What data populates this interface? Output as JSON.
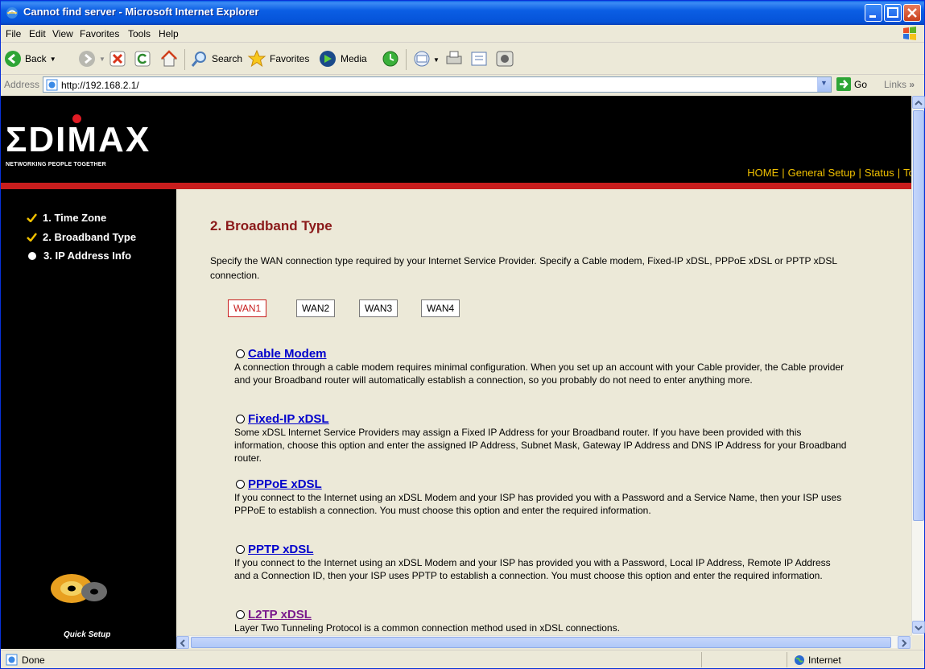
{
  "window": {
    "title": "Cannot find server - Microsoft Internet Explorer"
  },
  "menu": [
    "File",
    "Edit",
    "View",
    "Favorites",
    "Tools",
    "Help"
  ],
  "toolbar": {
    "back_label": "Back",
    "search_label": "Search",
    "favorites_label": "Favorites",
    "media_label": "Media"
  },
  "address": {
    "label": "Address",
    "url": "http://192.168.2.1/",
    "go_label": "Go",
    "links_label": "Links"
  },
  "brand": {
    "logo": "ΣDIMAX",
    "tagline": "NETWORKING PEOPLE TOGETHER"
  },
  "topnav": [
    "HOME",
    "General Setup",
    "Status",
    "Tool"
  ],
  "sidebar": {
    "items": [
      {
        "label": "1. Time Zone",
        "state": "checked"
      },
      {
        "label": "2. Broadband Type",
        "state": "checked"
      },
      {
        "label": "3. IP Address Info",
        "state": "current"
      }
    ],
    "quick_setup_label": "Quick Setup"
  },
  "content": {
    "title": "2. Broadband Type",
    "description": "Specify the WAN connection type required by your Internet Service Provider. Specify a Cable modem, Fixed-IP xDSL, PPPoE xDSL or PPTP xDSL connection.",
    "wan_buttons": [
      "WAN1",
      "WAN2",
      "WAN3",
      "WAN4"
    ],
    "options": [
      {
        "label": "Cable Modem",
        "text": "A connection through a cable modem requires minimal configuration. When you set up an account with your Cable provider, the Cable provider and your Broadband router will automatically establish a connection, so you probably do not need to enter anything more."
      },
      {
        "label": "Fixed-IP xDSL",
        "text": "Some xDSL Internet Service Providers may assign a Fixed IP Address for your Broadband router. If you have been provided with this information, choose this option and enter the assigned IP Address, Subnet Mask, Gateway IP Address and DNS IP Address for your Broadband router."
      },
      {
        "label": "PPPoE xDSL",
        "text": "If you connect to the Internet using an xDSL Modem and your ISP has provided you with a Password and a Service Name, then your ISP uses PPPoE to establish a connection. You must choose this option and enter the required information."
      },
      {
        "label": "PPTP xDSL",
        "text": "If you connect to the Internet using an xDSL Modem and your ISP has provided you with a Password, Local IP Address, Remote IP Address and a Connection ID, then your ISP uses PPTP to establish a connection. You must choose this option and enter the required information."
      },
      {
        "label": "L2TP xDSL",
        "text": "Layer Two Tunneling Protocol is a common connection method used in xDSL connections."
      }
    ]
  },
  "status": {
    "text": "Done",
    "zone": "Internet"
  },
  "colors": {
    "title_accent": "#8b1a1a",
    "nav_yellow": "#f0c000",
    "brand_red": "#c81d1d",
    "link_blue": "#0000cc"
  }
}
